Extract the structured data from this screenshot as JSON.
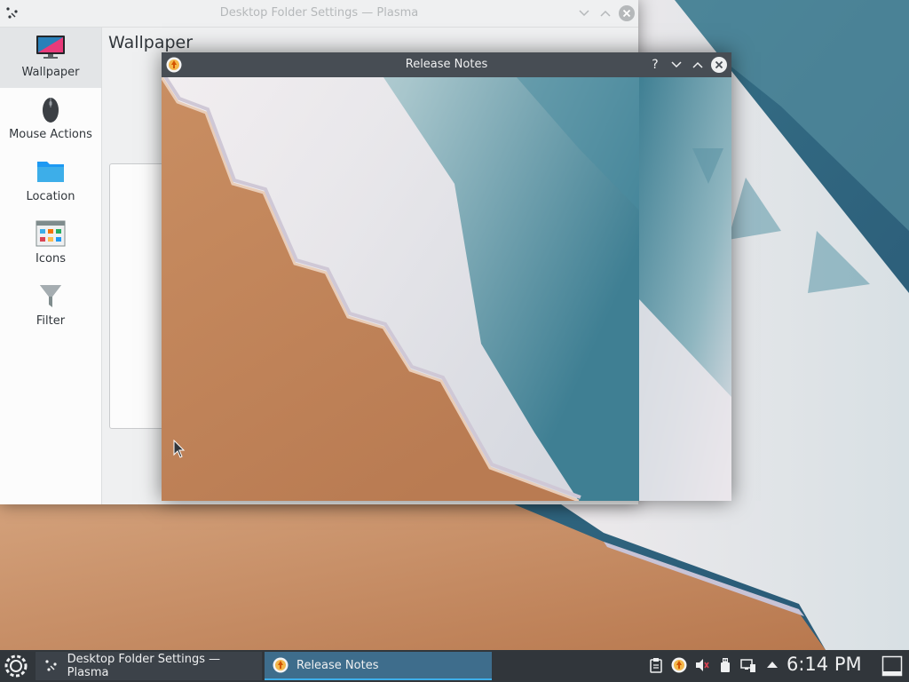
{
  "settings_window": {
    "title": "Desktop Folder Settings — Plasma",
    "heading": "Wallpaper",
    "sidebar": [
      {
        "label": "Wallpaper",
        "icon": "monitor-icon",
        "active": true
      },
      {
        "label": "Mouse Actions",
        "icon": "mouse-icon",
        "active": false
      },
      {
        "label": "Location",
        "icon": "folder-icon",
        "active": false
      },
      {
        "label": "Icons",
        "icon": "icons-grid-icon",
        "active": false
      },
      {
        "label": "Filter",
        "icon": "funnel-icon",
        "active": false
      }
    ]
  },
  "release_notes_window": {
    "title": "Release Notes"
  },
  "taskbar": {
    "tasks": [
      {
        "label": "Desktop Folder Settings — Plasma",
        "icon": "plasma-icon"
      },
      {
        "label": "Release Notes",
        "icon": "discover-icon"
      }
    ],
    "clock": "6:14 PM",
    "tray_icons": [
      "clipboard-icon",
      "updates-icon",
      "volume-muted-icon",
      "usb-drive-icon",
      "network-icon",
      "expand-tray-icon",
      "show-desktop-icon"
    ]
  },
  "colors": {
    "panel": "#31363b",
    "accent": "#3daee9",
    "sand": "#c98e62",
    "sea": "#3f7d90"
  }
}
